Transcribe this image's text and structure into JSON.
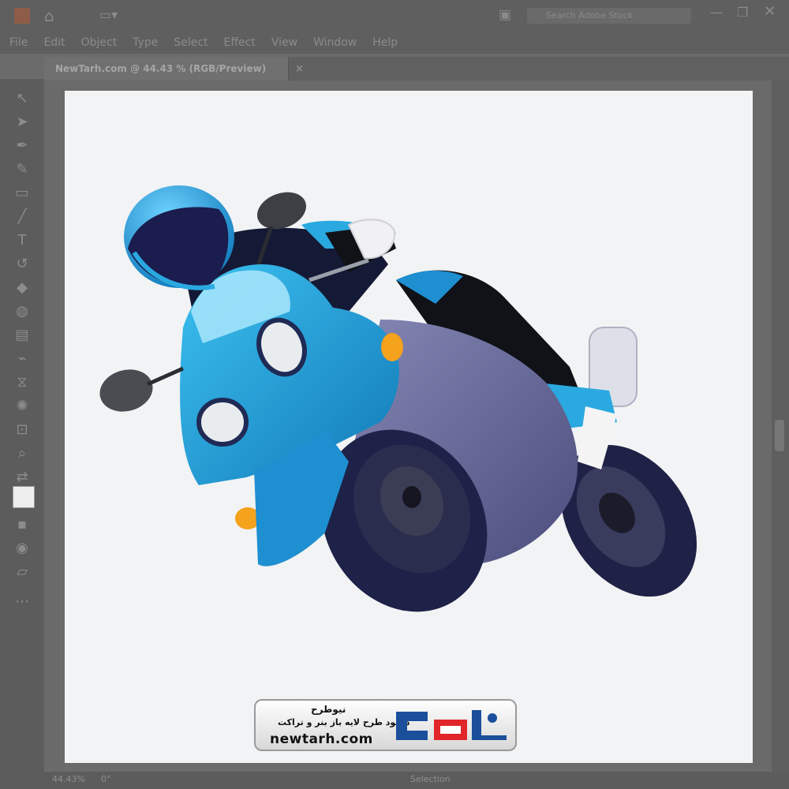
{
  "app": {
    "menu": [
      "File",
      "Edit",
      "Object",
      "Type",
      "Select",
      "Effect",
      "View",
      "Window",
      "Help"
    ],
    "search_placeholder": "Search Adobe Stock",
    "home_icon": "home-icon",
    "workspace_icon": "workspace-switcher-icon"
  },
  "document": {
    "tab_title": "NewTarh.com @ 44.43 % (RGB/Preview)",
    "close_glyph": "×"
  },
  "status": {
    "zoom": "44.43%",
    "rotation": "0°",
    "tool_name": "Selection"
  },
  "watermark": {
    "brand": "نیوطرح",
    "tagline": "دانلود طرح لایه باز بنر و تراکت",
    "url": "newtarh.com",
    "logo_text": "نیوطرح",
    "colors": {
      "accent_red": "#e0262a",
      "accent_blue": "#1b4f9c"
    }
  },
  "artwork": {
    "subject": "motorcycle-rider-illustration",
    "colors": {
      "body_blue": "#2aa9e0",
      "dark_navy": "#1f2a55",
      "tire": "#1c1e3a",
      "fairing": "#6b6e9c"
    }
  }
}
